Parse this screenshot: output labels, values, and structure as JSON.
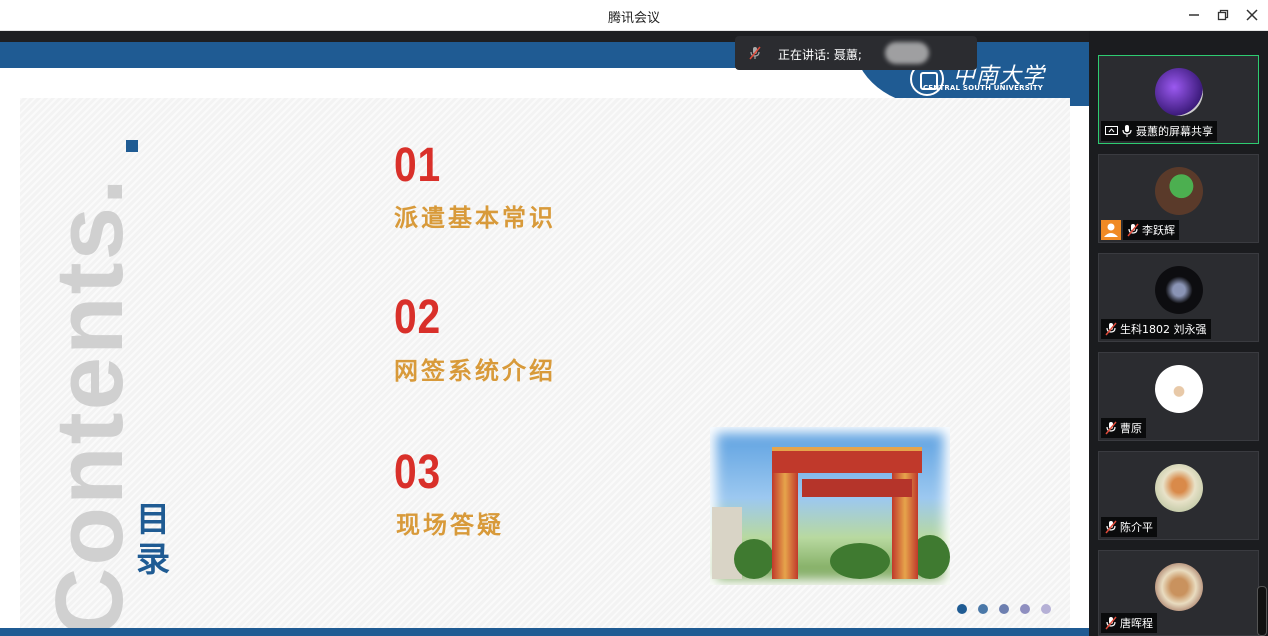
{
  "window": {
    "title": "腾讯会议"
  },
  "speaking": {
    "label": "正在讲话: 聂蕙;"
  },
  "slide": {
    "watermark_word": "Contents.",
    "section_title": "目录",
    "logo": {
      "cn": "中南大学",
      "en": "CENTRAL SOUTH UNIVERSITY"
    },
    "items": [
      {
        "num": "01",
        "label": "派遣基本常识"
      },
      {
        "num": "02",
        "label": "网签系统介绍"
      },
      {
        "num": "03",
        "label": "现场答疑"
      }
    ],
    "pager": {
      "count": 5,
      "current": 1
    }
  },
  "participants": [
    {
      "name": "聂蕙的屏幕共享",
      "status": "screen-share",
      "active": true
    },
    {
      "name": "李跃辉",
      "status": "muted",
      "badge": "person"
    },
    {
      "name": "生科1802 刘永强",
      "status": "muted"
    },
    {
      "name": "曹原",
      "status": "muted"
    },
    {
      "name": "陈介平",
      "status": "muted"
    },
    {
      "name": "唐晖程",
      "status": "muted"
    }
  ],
  "colors": {
    "brand_blue": "#1f5b93",
    "number_red": "#d9302a",
    "label_gold": "#d89a3a",
    "active_green": "#2ecc71"
  }
}
